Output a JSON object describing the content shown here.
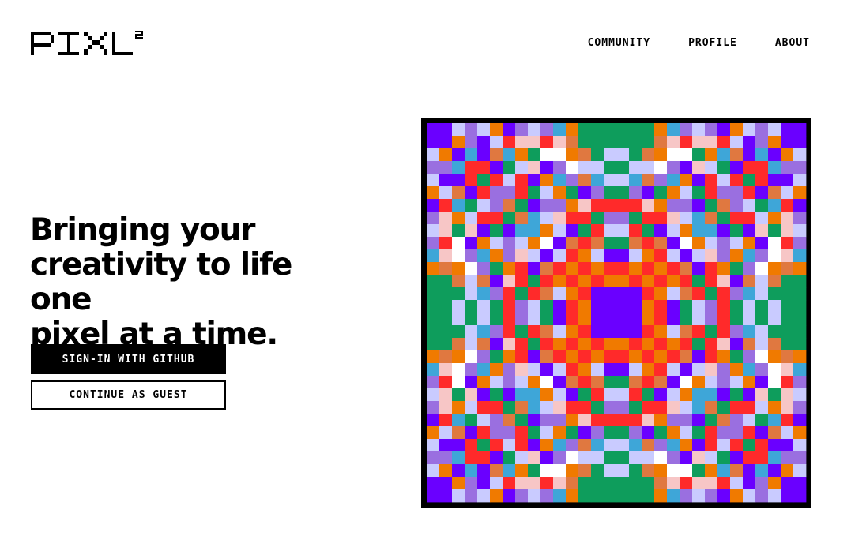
{
  "brand": {
    "name": "PIXL",
    "superscript": "2"
  },
  "nav": {
    "items": [
      {
        "label": "COMMUNITY"
      },
      {
        "label": "PROFILE"
      },
      {
        "label": "ABOUT"
      }
    ]
  },
  "hero": {
    "headline_lines": [
      "Bringing your",
      "creativity to life one",
      "pixel at a time."
    ],
    "primary_button": "SIGN-IN WITH GITHUB",
    "secondary_button": "CONTINUE AS GUEST"
  },
  "art": {
    "frame_color": "#000000",
    "palette": [
      "#6a00ff",
      "#f7c6c6",
      "#ff2a2a",
      "#0e9d5c",
      "#f07a00",
      "#3ea6d8",
      "#9a6fe0",
      "#c9cbff",
      "#ffffff",
      "#e07840"
    ],
    "grid_size": 30
  }
}
